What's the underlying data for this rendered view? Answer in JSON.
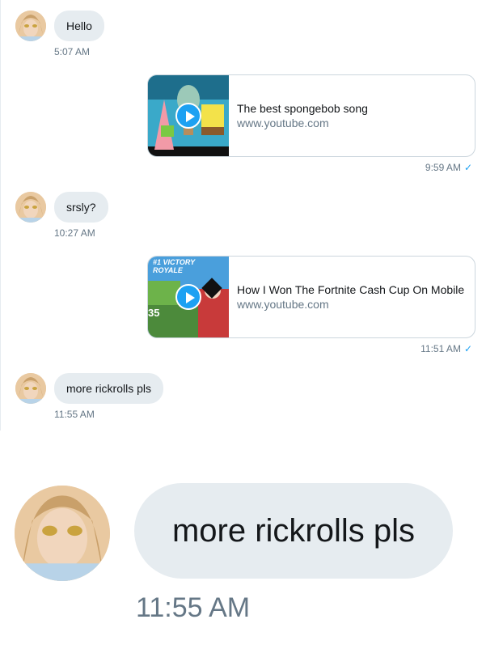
{
  "conversation": {
    "messages": [
      {
        "text": "Hello",
        "time": "5:07 AM"
      },
      {
        "text": "srsly?",
        "time": "10:27 AM"
      },
      {
        "text": "more rickrolls pls",
        "time": "11:55 AM"
      }
    ],
    "cards": [
      {
        "title": "The best spongebob song",
        "url": "www.youtube.com",
        "time": "9:59 AM",
        "thumb": "spongebob-thumbnail",
        "thumb_badge": ""
      },
      {
        "title": "How I Won The Fortnite Cash Cup On Mobile",
        "url": "www.youtube.com",
        "time": "11:51 AM",
        "thumb": "fortnite-thumbnail",
        "thumb_badge": "#1 VICTORY ROYALE",
        "thumb_number": "35"
      }
    ]
  },
  "zoomed": {
    "text": "more rickrolls pls",
    "time": "11:55 AM"
  },
  "icons": {
    "play": "play-icon",
    "check": "check-icon",
    "avatar": "avatar"
  },
  "colors": {
    "bubble": "#e6ecf0",
    "accent": "#1da1f2",
    "muted": "#657786"
  }
}
